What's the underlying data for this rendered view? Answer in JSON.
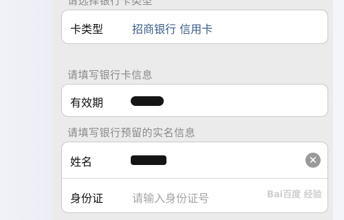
{
  "sections": {
    "card_type_header": "请选择银行卡类型",
    "bank_info_header": "请填写银行卡信息",
    "real_name_header": "请填写银行预留的实名信息"
  },
  "card_type": {
    "label": "卡类型",
    "value": "招商银行 信用卡"
  },
  "expiry": {
    "label": "有效期"
  },
  "name": {
    "label": "姓名",
    "clear_icon": "✕"
  },
  "id_card": {
    "label": "身份证",
    "placeholder": "请输入身份证号"
  },
  "watermark": "Bai百度 经验",
  "colors": {
    "value_blue": "#385d8a",
    "placeholder_gray": "#a5a5a5"
  }
}
